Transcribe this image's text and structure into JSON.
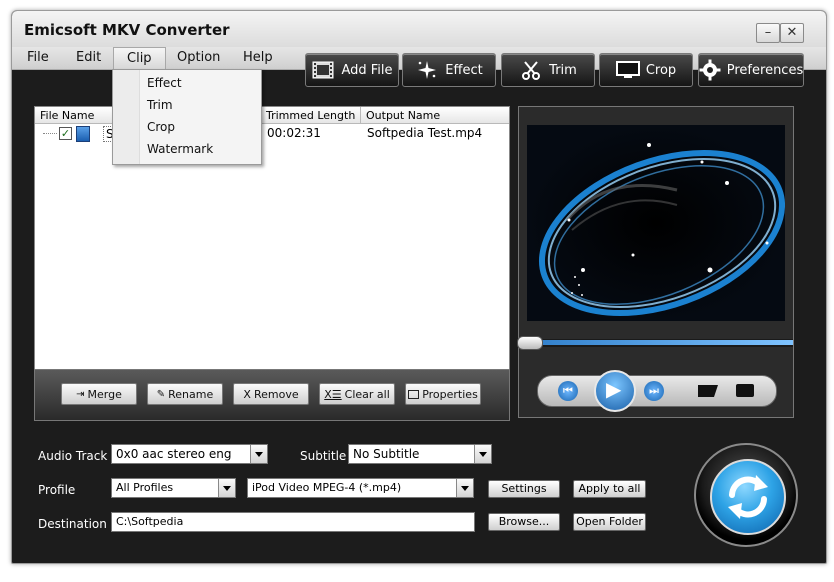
{
  "window": {
    "title": "Emicsoft MKV Converter"
  },
  "menu": {
    "file": "File",
    "edit": "Edit",
    "clip": "Clip",
    "option": "Option",
    "help": "Help"
  },
  "clip_menu": {
    "items": [
      "Effect",
      "Trim",
      "Crop",
      "Watermark"
    ]
  },
  "toolbar": {
    "add_file": "Add File",
    "effect": "Effect",
    "trim": "Trim",
    "crop": "Crop",
    "preferences": "Preferences"
  },
  "file_list": {
    "columns": {
      "file_name": "File Name",
      "trimmed_length": "Trimmed Length",
      "output_name": "Output Name"
    },
    "rows": [
      {
        "name_fragment": "S",
        "trimmed_length": "00:02:31",
        "output_name": "Softpedia Test.mp4",
        "checked": true
      }
    ]
  },
  "list_buttons": {
    "merge": "Merge",
    "rename": "Rename",
    "remove": "Remove",
    "clear_all": "Clear all",
    "properties": "Properties"
  },
  "settings": {
    "audio_track_label": "Audio Track",
    "audio_track_value": "0x0 aac stereo eng",
    "subtitle_label": "Subtitle",
    "subtitle_value": "No Subtitle",
    "profile_label": "Profile",
    "profile_category": "All Profiles",
    "profile_value": "iPod Video MPEG-4 (*.mp4)",
    "settings_button": "Settings",
    "apply_to_all_button": "Apply to all",
    "destination_label": "Destination",
    "destination_value": "C:\\Softpedia",
    "browse_button": "Browse...",
    "open_folder_button": "Open Folder"
  },
  "colors": {
    "accent": "#2e9be0",
    "background": "#1c1c1c"
  }
}
